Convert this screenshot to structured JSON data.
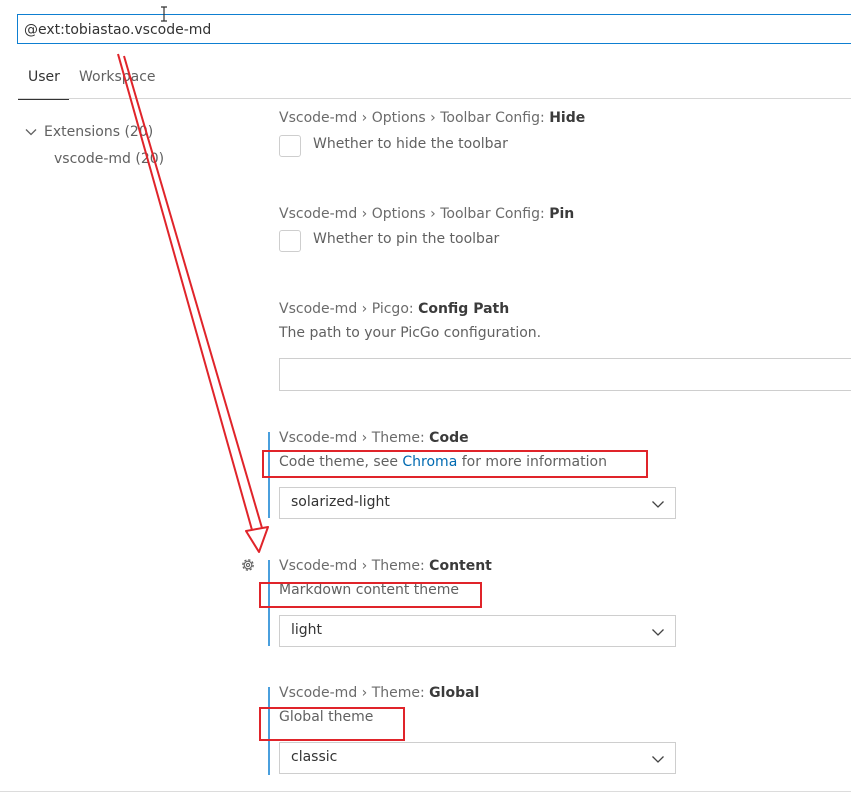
{
  "search": {
    "value": "@ext:tobiastao.vscode-md"
  },
  "tabs": [
    {
      "label": "User"
    },
    {
      "label": "Workspace"
    }
  ],
  "tree": {
    "group": {
      "label": "Extensions (20)"
    },
    "item": {
      "label": "vscode-md (20)"
    }
  },
  "settings": {
    "hide_toolbar": {
      "prefix": "Vscode-md › Options › Toolbar Config: ",
      "name": "Hide",
      "description": "Whether to hide the toolbar"
    },
    "pin_toolbar": {
      "prefix": "Vscode-md › Options › Toolbar Config: ",
      "name": "Pin",
      "description": "Whether to pin the toolbar"
    },
    "picgo": {
      "prefix": "Vscode-md › Picgo: ",
      "name": "Config Path",
      "description": "The path to your PicGo configuration.",
      "value": ""
    },
    "theme_code": {
      "prefix": "Vscode-md › Theme: ",
      "name": "Code",
      "desc_before": "Code theme, see ",
      "desc_link": "Chroma",
      "desc_after": " for more information",
      "value": "solarized-light"
    },
    "theme_content": {
      "prefix": "Vscode-md › Theme: ",
      "name": "Content",
      "description": "Markdown content theme",
      "value": "light"
    },
    "theme_global": {
      "prefix": "Vscode-md › Theme: ",
      "name": "Global",
      "description": "Global theme",
      "value": "classic"
    }
  },
  "icons": {
    "gear": "gear-icon",
    "chevron": "chevron-down-icon",
    "tree_chevron": "chevron-down-icon",
    "text_cursor": "text-cursor-icon"
  },
  "colors": {
    "accent": "#0e7fd1",
    "annotation": "#e0242a",
    "link": "#006ab1"
  }
}
